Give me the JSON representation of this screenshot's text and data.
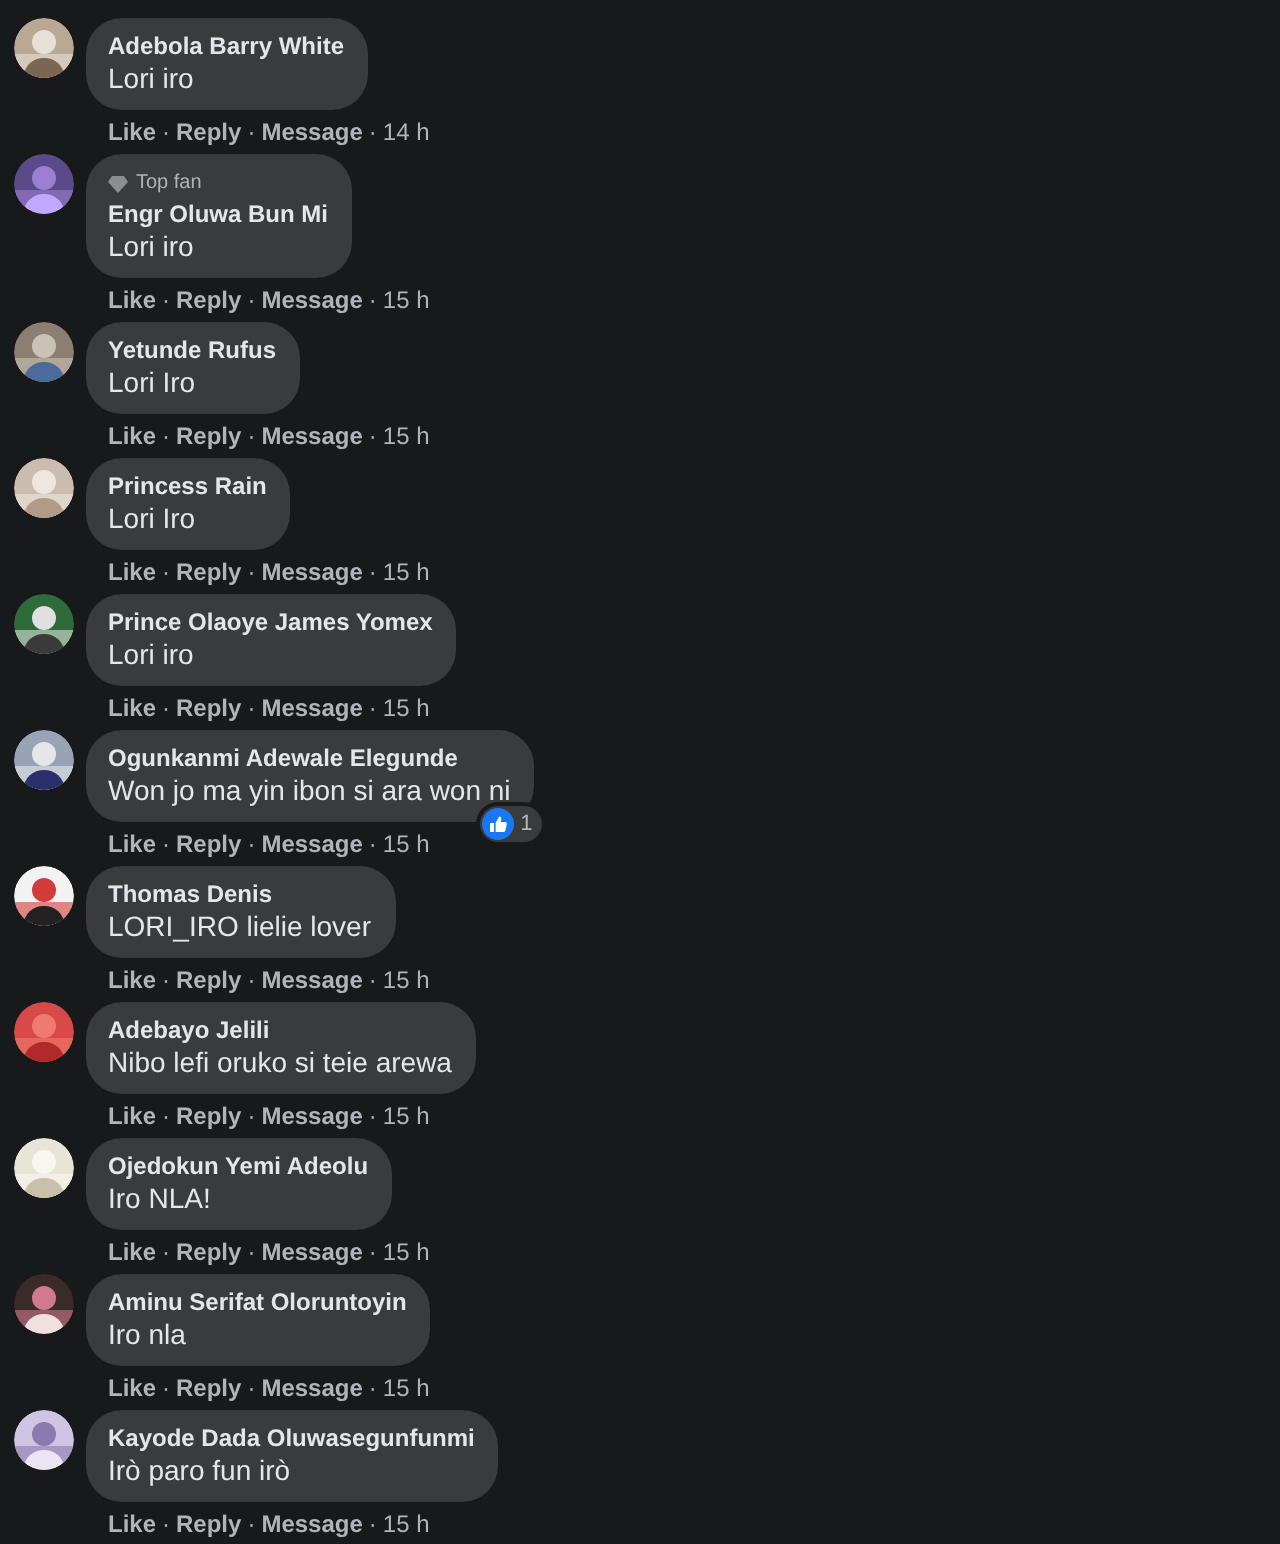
{
  "comments": [
    {
      "name": "Adebola Barry White",
      "text": "Lori iro",
      "actions": [
        "Like",
        "Reply",
        "Message"
      ],
      "time": "14 h"
    },
    {
      "badge": "Top fan",
      "name": "Engr Oluwa Bun Mi",
      "text": "Lori iro",
      "actions": [
        "Like",
        "Reply",
        "Message"
      ],
      "time": "15 h"
    },
    {
      "name": "Yetunde Rufus",
      "text": "Lori Iro",
      "actions": [
        "Like",
        "Reply",
        "Message"
      ],
      "time": "15 h"
    },
    {
      "name": "Princess Rain",
      "text": "Lori Iro",
      "actions": [
        "Like",
        "Reply",
        "Message"
      ],
      "time": "15 h"
    },
    {
      "name": "Prince Olaoye James Yomex",
      "text": "Lori iro",
      "actions": [
        "Like",
        "Reply",
        "Message"
      ],
      "time": "15 h"
    },
    {
      "name": "Ogunkanmi Adewale Elegunde",
      "text": "Won jo ma yin ibon si ara won ni",
      "reactions": "1",
      "actions": [
        "Like",
        "Reply",
        "Message"
      ],
      "time": "15 h"
    },
    {
      "name": "Thomas Denis",
      "text": "LORI_IRO lielie lover",
      "actions": [
        "Like",
        "Reply",
        "Message"
      ],
      "time": "15 h"
    },
    {
      "name": "Adebayo Jelili",
      "text": "Nibo lefi oruko si teie arewa",
      "actions": [
        "Like",
        "Reply",
        "Message"
      ],
      "time": "15 h"
    },
    {
      "name": "Ojedokun Yemi Adeolu",
      "text": "Iro NLA!",
      "actions": [
        "Like",
        "Reply",
        "Message"
      ],
      "time": "15 h"
    },
    {
      "name": "Aminu Serifat Oloruntoyin",
      "text": "Iro nla",
      "actions": [
        "Like",
        "Reply",
        "Message"
      ],
      "time": "15 h"
    },
    {
      "name": "Kayode Dada Oluwasegunfunmi",
      "text": "Irò paro fun irò",
      "actions": [
        "Like",
        "Reply",
        "Message"
      ],
      "time": "15 h"
    }
  ],
  "separator": "·"
}
